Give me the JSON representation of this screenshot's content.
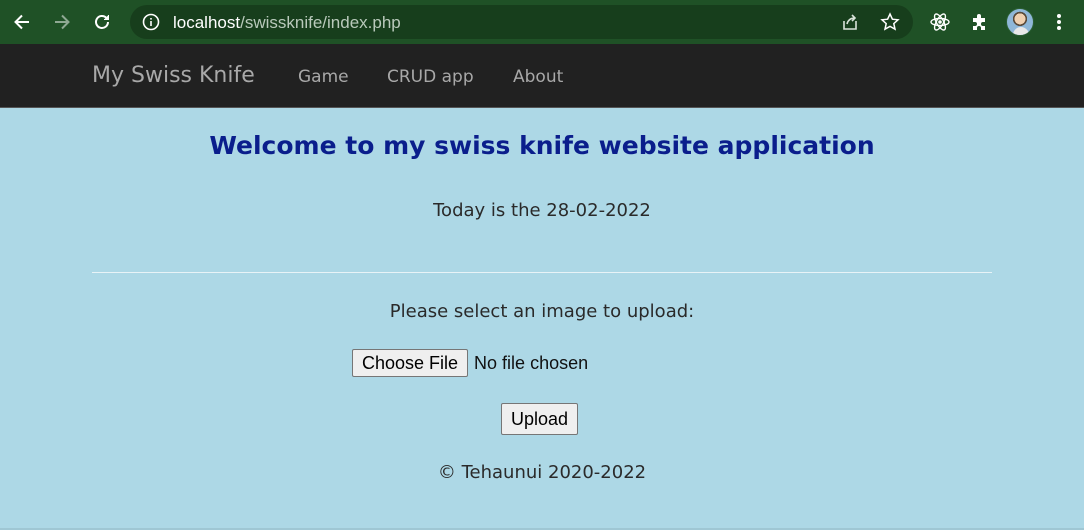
{
  "browser": {
    "url_host": "localhost",
    "url_path": "/swissknife/index.php"
  },
  "navbar": {
    "brand": "My Swiss Knife",
    "links": [
      "Game",
      "CRUD app",
      "About"
    ]
  },
  "main": {
    "title": "Welcome to my swiss knife website application",
    "date_text": "Today is the 28-02-2022",
    "upload_prompt": "Please select an image to upload:",
    "choose_file_label": "Choose File",
    "file_status": "No file chosen",
    "upload_label": "Upload"
  },
  "footer": {
    "copyright": "© Tehaunui 2020-2022"
  },
  "colors": {
    "page_background": "#add8e6",
    "navbar_background": "#212121",
    "title_color": "#0a1e8c",
    "browser_frame": "#1f5126"
  }
}
